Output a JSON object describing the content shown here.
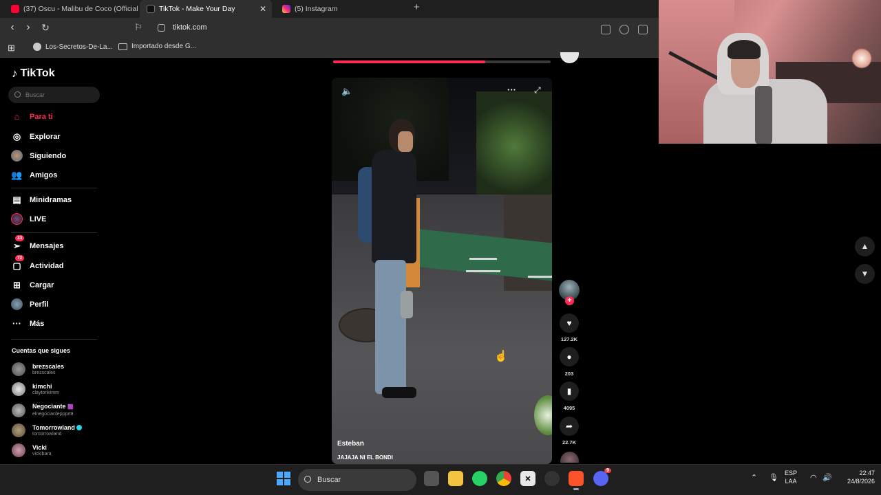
{
  "browser": {
    "tabs": [
      {
        "title": "(37) Oscu - Malibu de Coco (Official",
        "favicon_color": "#ff0033",
        "active": false
      },
      {
        "title": "TikTok - Make Your Day",
        "favicon_color": "#111111",
        "active": true
      },
      {
        "title": "(5) Instagram",
        "favicon_color": "#d6249f",
        "active": false
      }
    ],
    "close_tab": "✕",
    "new_tab": "+",
    "url": "tiktok.com",
    "bookmarks": [
      {
        "label": "Los-Secretos-De-La..."
      },
      {
        "label": "Importado desde G..."
      }
    ]
  },
  "tiktok": {
    "brand": "TikTok",
    "search_placeholder": "Buscar",
    "nav": [
      {
        "label": "Para ti",
        "icon": "home-icon",
        "active": true
      },
      {
        "label": "Explorar",
        "icon": "compass-icon"
      },
      {
        "label": "Siguiendo",
        "icon": "following-avatar-icon"
      },
      {
        "label": "Amigos",
        "icon": "friends-icon"
      },
      {
        "label": "Minidramas",
        "icon": "film-icon"
      },
      {
        "label": "LIVE",
        "icon": "live-icon"
      },
      {
        "label": "Mensajes",
        "icon": "messages-icon",
        "badge": "33"
      },
      {
        "label": "Actividad",
        "icon": "activity-icon",
        "badge": "72"
      },
      {
        "label": "Cargar",
        "icon": "upload-icon"
      },
      {
        "label": "Perfil",
        "icon": "profile-avatar-icon"
      },
      {
        "label": "Más",
        "icon": "more-icon"
      }
    ],
    "following_title": "Cuentas que sigues",
    "following": [
      {
        "name": "brezscales",
        "handle": "brezscales",
        "verified": false
      },
      {
        "name": "kimchi",
        "handle": "claytonkimm",
        "verified": false
      },
      {
        "name": "Negociante",
        "handle": "elnegocianteppprt8",
        "verified": false,
        "emoji": "🟪"
      },
      {
        "name": "Tomorrowland",
        "handle": "tomorrowland",
        "verified": true
      },
      {
        "name": "Vicki",
        "handle": "vickibara",
        "verified": false
      }
    ],
    "video": {
      "author": "Esteban",
      "caption": "JAJAJA NI EL BONDI",
      "prev_progress": 0.7
    },
    "actions": {
      "likes": "127.2K",
      "comments": "203",
      "saves": "4095",
      "shares": "22.7K"
    }
  },
  "taskbar": {
    "search_placeholder": "Buscar",
    "language": "ESP",
    "layout": "LAA",
    "time": "22:47",
    "date": "24/8/2026",
    "discord_badge": "9"
  }
}
